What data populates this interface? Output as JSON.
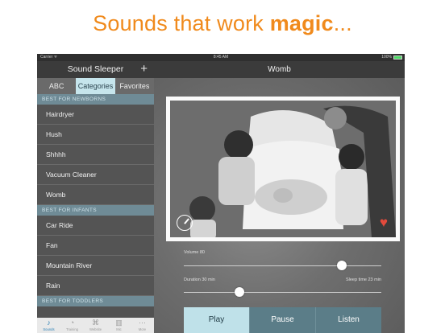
{
  "headline": {
    "normal": "Sounds that work ",
    "bold": "magic",
    "suffix": "..."
  },
  "status_bar": {
    "carrier": "Carrier ᯤ",
    "time": "8:45 AM",
    "battery": "100%",
    "battery_level": 1.0
  },
  "left_panel": {
    "title": "Sound Sleeper",
    "add_icon": "+",
    "segments": [
      "ABC",
      "Categories",
      "Favorites"
    ],
    "selected_segment": "Categories",
    "sections": [
      {
        "header": "BEST FOR NEWBORNS",
        "items": [
          "Hairdryer",
          "Hush",
          "Shhhh",
          "Vacuum Cleaner",
          "Womb"
        ]
      },
      {
        "header": "BEST FOR INFANTS",
        "items": [
          "Car Ride",
          "Fan",
          "Mountain River",
          "Rain"
        ]
      },
      {
        "header": "BEST FOR TODDLERS",
        "items": []
      }
    ]
  },
  "tab_bar": {
    "tabs": [
      {
        "label": "Sounds",
        "icon": "music-note-icon",
        "glyph": "♪"
      },
      {
        "label": "Training",
        "icon": "chart-icon",
        "glyph": "◔"
      },
      {
        "label": "Website",
        "icon": "tag-icon",
        "glyph": "⌘"
      },
      {
        "label": "Mic",
        "icon": "mic-icon",
        "glyph": "▥"
      },
      {
        "label": "More",
        "icon": "more-icon",
        "glyph": "⋯"
      }
    ],
    "active": "Sounds"
  },
  "now_playing": {
    "title": "Womb",
    "image_icon": "baby-photo",
    "timer_icon": "timer-icon",
    "favorite_icon": "heart-icon",
    "volume_label": "Volume 80",
    "volume_value": 80,
    "duration_label": "Duration 30 min",
    "sleep_label": "Sleep time 23 min",
    "duration_fraction": 0.28
  },
  "controls": {
    "play": "Play",
    "pause": "Pause",
    "listen": "Listen",
    "active": "Play"
  },
  "colors": {
    "accent_orange": "#f08a1c",
    "segment_active": "#c6e5ec",
    "section_header": "#6f8b96",
    "heart": "#e34a3c"
  }
}
